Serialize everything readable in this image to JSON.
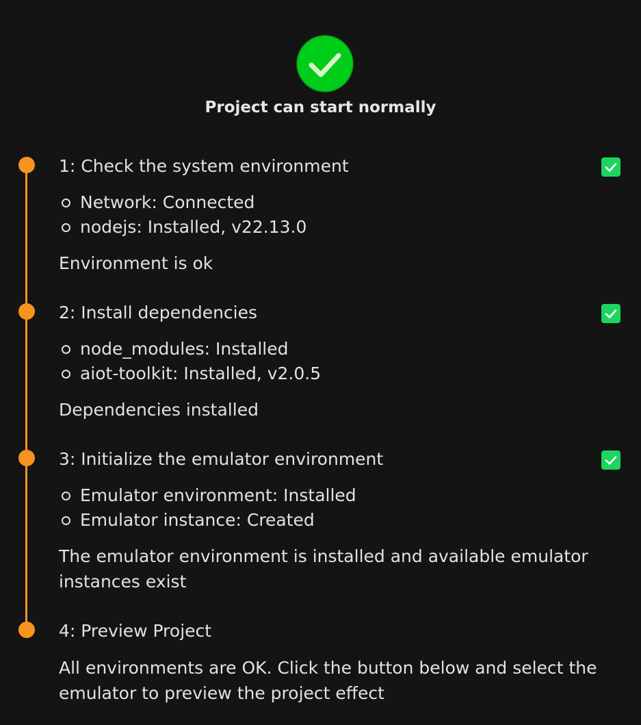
{
  "header": {
    "icon": "success-check-icon",
    "title": "Project can start normally"
  },
  "colors": {
    "background": "#141414",
    "timeline": "#f7931e",
    "success": "#1ed460",
    "status_icon": "#00cc1a",
    "text": "#e2e2e2"
  },
  "steps": [
    {
      "title": "1: Check the system environment",
      "status": "checked",
      "details": [
        "Network: Connected",
        "nodejs: Installed, v22.13.0"
      ],
      "summary": "Environment is ok"
    },
    {
      "title": "2: Install dependencies",
      "status": "checked",
      "details": [
        "node_modules: Installed",
        "aiot-toolkit: Installed, v2.0.5"
      ],
      "summary": "Dependencies installed"
    },
    {
      "title": "3: Initialize the emulator environment",
      "status": "checked",
      "details": [
        "Emulator environment: Installed",
        "Emulator instance: Created"
      ],
      "summary": "The emulator environment is installed and available emulator instances exist"
    },
    {
      "title": "4: Preview Project",
      "status": "pending",
      "details": [],
      "summary": "All environments are OK. Click the button below and select the emulator to preview the project effect"
    }
  ]
}
